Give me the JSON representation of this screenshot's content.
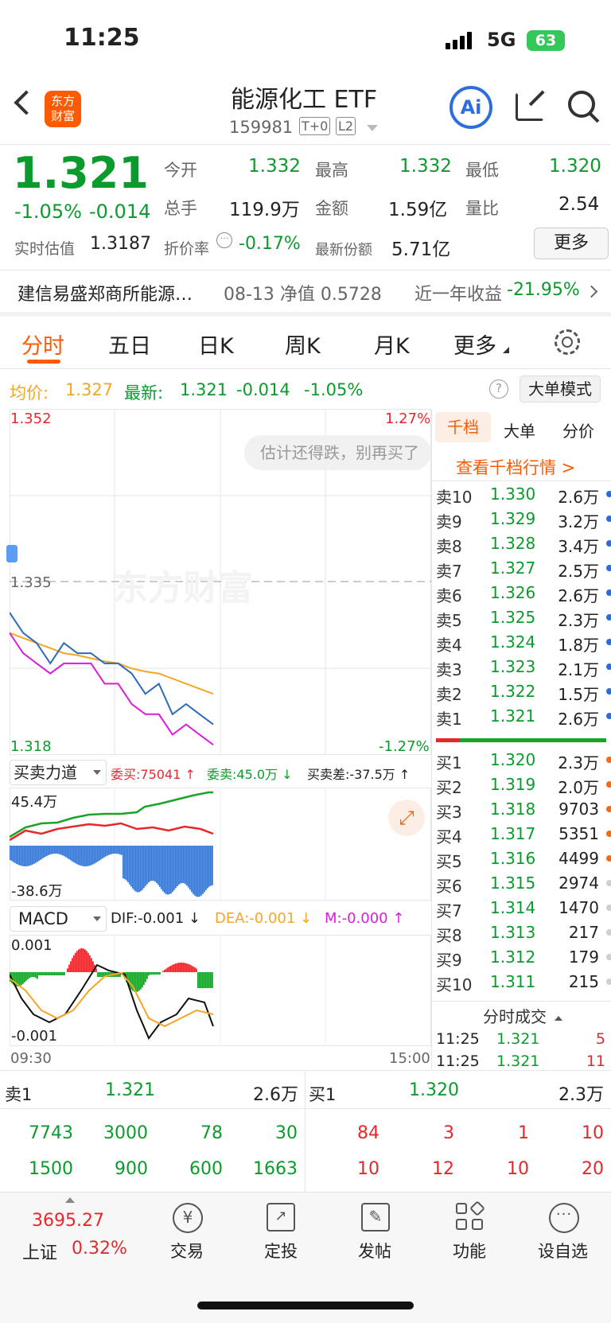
{
  "status": {
    "time": "11:25",
    "network": "5G",
    "battery": "63"
  },
  "header": {
    "title": "能源化工 ETF",
    "code": "159981",
    "badge1": "T+0",
    "badge2": "L2",
    "ai": "Ai"
  },
  "quote": {
    "price": "1.321",
    "pct": "-1.05%",
    "chg": "-0.014",
    "est_label": "实时估值",
    "est_value": "1.3187",
    "open_l": "今开",
    "open": "1.332",
    "high_l": "最高",
    "high": "1.332",
    "low_l": "最低",
    "low": "1.320",
    "vol_l": "总手",
    "vol": "119.9万",
    "amt_l": "金额",
    "amt": "1.59亿",
    "vr_l": "量比",
    "vr": "2.54",
    "prem_l": "折价率",
    "prem": "-0.17%",
    "share_l": "最新份额",
    "share": "5.71亿",
    "more": "更多"
  },
  "fund": {
    "name": "建信易盛郑商所能源…",
    "nav": "08-13 净值 0.5728",
    "ret_l": "近一年收益",
    "ret": "-21.95%"
  },
  "tabs": [
    "分时",
    "五日",
    "日K",
    "周K",
    "月K",
    "更多"
  ],
  "chart_info": {
    "avg_l": "均价:",
    "avg": "1.327",
    "last_l": "最新:",
    "last": "1.321",
    "chg": "-0.014",
    "pct": "-1.05%",
    "mode": "大单模式",
    "q": "?"
  },
  "chart": {
    "ymax": "1.352",
    "ymin": "1.318",
    "pmax": "1.27%",
    "pmin": "-1.27%",
    "mid": "1.335",
    "toast": "估计还得跌，别再买了",
    "time_start": "09:30",
    "time_end": "15:00",
    "watermark": "东方财富"
  },
  "chart_data": {
    "type": "line",
    "ylim": [
      1.318,
      1.352
    ],
    "xlabel": "",
    "ylabel": "",
    "series": [
      {
        "name": "均价",
        "values": [
          1.33,
          1.3295,
          1.329,
          1.3285,
          1.328,
          1.3278,
          1.3275,
          1.3272,
          1.327,
          1.3265,
          1.3262,
          1.326,
          1.3255,
          1.325,
          1.3245,
          1.324
        ]
      },
      {
        "name": "最新",
        "values": [
          1.332,
          1.33,
          1.329,
          1.327,
          1.329,
          1.328,
          1.328,
          1.327,
          1.327,
          1.326,
          1.324,
          1.325,
          1.322,
          1.323,
          1.322,
          1.321
        ]
      },
      {
        "name": "净值",
        "values": [
          1.33,
          1.328,
          1.327,
          1.326,
          1.327,
          1.327,
          1.327,
          1.325,
          1.325,
          1.323,
          1.322,
          1.322,
          1.32,
          1.321,
          1.32,
          1.319
        ]
      }
    ]
  },
  "force": {
    "title": "买卖力道",
    "buy": "委买:75041 ↑",
    "sell": "委卖:45.0万 ↓",
    "diff": "买卖差:-37.5万 ↑",
    "top": "45.4万",
    "bottom": "-38.6万"
  },
  "macd": {
    "title": "MACD",
    "dif": "DIF:-0.001 ↓",
    "dea": "DEA:-0.001 ↓",
    "m": "M:-0.000 ↑",
    "top": "0.001",
    "bottom": "-0.001"
  },
  "book": {
    "tabs": [
      "千档",
      "大单",
      "分价"
    ],
    "link": "查看千档行情 >",
    "asks": [
      {
        "l": "卖10",
        "p": "1.330",
        "v": "2.6万"
      },
      {
        "l": "卖9",
        "p": "1.329",
        "v": "3.2万"
      },
      {
        "l": "卖8",
        "p": "1.328",
        "v": "3.4万"
      },
      {
        "l": "卖7",
        "p": "1.327",
        "v": "2.5万"
      },
      {
        "l": "卖6",
        "p": "1.326",
        "v": "2.6万"
      },
      {
        "l": "卖5",
        "p": "1.325",
        "v": "2.3万"
      },
      {
        "l": "卖4",
        "p": "1.324",
        "v": "1.8万"
      },
      {
        "l": "卖3",
        "p": "1.323",
        "v": "2.1万"
      },
      {
        "l": "卖2",
        "p": "1.322",
        "v": "1.5万"
      },
      {
        "l": "卖1",
        "p": "1.321",
        "v": "2.6万"
      }
    ],
    "bids": [
      {
        "l": "买1",
        "p": "1.320",
        "v": "2.3万"
      },
      {
        "l": "买2",
        "p": "1.319",
        "v": "2.0万"
      },
      {
        "l": "买3",
        "p": "1.318",
        "v": "9703"
      },
      {
        "l": "买4",
        "p": "1.317",
        "v": "5351"
      },
      {
        "l": "买5",
        "p": "1.316",
        "v": "4499"
      },
      {
        "l": "买6",
        "p": "1.315",
        "v": "2974"
      },
      {
        "l": "买7",
        "p": "1.314",
        "v": "1470"
      },
      {
        "l": "买8",
        "p": "1.313",
        "v": "217"
      },
      {
        "l": "买9",
        "p": "1.312",
        "v": "179"
      },
      {
        "l": "买10",
        "p": "1.311",
        "v": "215"
      }
    ],
    "ticks_title": "分时成交",
    "ticks": [
      {
        "t": "11:25",
        "p": "1.321",
        "v": "5"
      },
      {
        "t": "11:25",
        "p": "1.321",
        "v": "11"
      }
    ]
  },
  "level": {
    "ask_l": "卖1",
    "ask_p": "1.321",
    "ask_v": "2.6万",
    "bid_l": "买1",
    "bid_p": "1.320",
    "bid_v": "2.3万",
    "ask_rows": [
      [
        "7743",
        "3000",
        "78",
        "30"
      ],
      [
        "1500",
        "900",
        "600",
        "1663"
      ]
    ],
    "bid_rows": [
      [
        "84",
        "3",
        "1",
        "10"
      ],
      [
        "10",
        "12",
        "10",
        "20"
      ]
    ]
  },
  "bottom": {
    "index_value": "3695.27",
    "index_name": "上证",
    "index_pct": "0.32%",
    "items": [
      {
        "label": "交易",
        "icon": "yen-icon"
      },
      {
        "label": "定投",
        "icon": "chart-calendar-icon"
      },
      {
        "label": "发帖",
        "icon": "edit-icon"
      },
      {
        "label": "功能",
        "icon": "grid-icon"
      },
      {
        "label": "设自选",
        "icon": "more-icon"
      }
    ]
  },
  "colors": {
    "up": "#e8272d",
    "down": "#0b9b2d",
    "avg": "#f5a623",
    "accent": "#ff5a00"
  }
}
